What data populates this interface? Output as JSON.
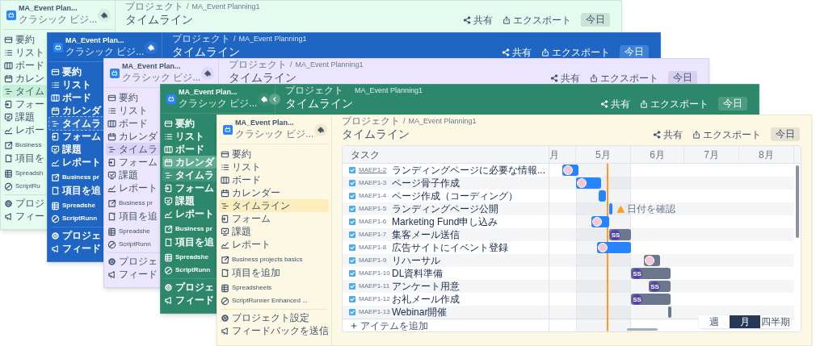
{
  "windows": [
    {
      "kind": "mint",
      "sidebar": {
        "project": "MA_Event Plan...",
        "type": "クラシック ビジ...",
        "items": [
          {
            "label": "要約",
            "selected": false,
            "hovered": false
          },
          {
            "label": "リスト",
            "selected": false,
            "hovered": false
          },
          {
            "label": "ボード",
            "selected": false,
            "hovered": false
          },
          {
            "label": "カレン",
            "selected": false,
            "hovered": false
          },
          {
            "label": "タイム",
            "selected": true,
            "hovered": false
          },
          {
            "label": "フォー",
            "selected": false,
            "hovered": false
          },
          {
            "label": "課題",
            "selected": false,
            "hovered": false
          },
          {
            "label": "レポー",
            "selected": false,
            "hovered": false
          },
          {
            "label": "Business",
            "selected": false,
            "hovered": false
          },
          {
            "label": "項目を",
            "selected": false,
            "hovered": false
          },
          {
            "label": "Spreadsh",
            "selected": false,
            "hovered": false
          },
          {
            "label": "ScriptRu",
            "selected": false,
            "hovered": false
          },
          {
            "label": "プロジ",
            "selected": false,
            "hovered": false
          },
          {
            "label": "フィー",
            "selected": false,
            "hovered": false
          }
        ]
      },
      "header": {
        "breadcrumb": [
          "プロジェクト",
          "MA_Event Planning1"
        ],
        "separator": "/",
        "title": "タイムライン",
        "share": "共有",
        "export": "エクスポート",
        "today": "今日"
      }
    },
    {
      "kind": "blue",
      "sidebar": {
        "project": "MA_Event Plan...",
        "type": "クラシック ビジ...",
        "items": [
          {
            "label": "要約",
            "selected": false,
            "hovered": false
          },
          {
            "label": "リスト",
            "selected": false,
            "hovered": false
          },
          {
            "label": "ボード",
            "selected": false,
            "hovered": false
          },
          {
            "label": "カレンダ",
            "selected": false,
            "hovered": false
          },
          {
            "label": "タイムラ",
            "selected": true,
            "hovered": false
          },
          {
            "label": "フォーム",
            "selected": false,
            "hovered": false
          },
          {
            "label": "課題",
            "selected": false,
            "hovered": false
          },
          {
            "label": "レポート",
            "selected": false,
            "hovered": false
          },
          {
            "label": "Business pr",
            "selected": false,
            "hovered": false
          },
          {
            "label": "項目を追",
            "selected": false,
            "hovered": false
          },
          {
            "label": "Spreadshe",
            "selected": false,
            "hovered": false
          },
          {
            "label": "ScriptRunn",
            "selected": false,
            "hovered": false
          },
          {
            "label": "プロジェ",
            "selected": false,
            "hovered": false
          },
          {
            "label": "フィード",
            "selected": false,
            "hovered": false
          }
        ]
      },
      "header": {
        "breadcrumb": [
          "プロジェクト",
          "MA_Event Planning1"
        ],
        "separator": "/",
        "title": "タイムライン",
        "share": "共有",
        "export": "エクスポート",
        "today": "今日"
      }
    },
    {
      "kind": "lavender",
      "sidebar": {
        "project": "MA_Event Plan...",
        "type": "クラシック ビジ...",
        "items": [
          {
            "label": "要約",
            "selected": false,
            "hovered": false
          },
          {
            "label": "リスト",
            "selected": false,
            "hovered": false
          },
          {
            "label": "ボード",
            "selected": false,
            "hovered": false
          },
          {
            "label": "カレンダ",
            "selected": false,
            "hovered": false
          },
          {
            "label": "タイムラ",
            "selected": true,
            "hovered": false
          },
          {
            "label": "フォーム",
            "selected": false,
            "hovered": false
          },
          {
            "label": "課題",
            "selected": false,
            "hovered": false
          },
          {
            "label": "レポート",
            "selected": false,
            "hovered": false
          },
          {
            "label": "Business pr",
            "selected": false,
            "hovered": false
          },
          {
            "label": "項目を追",
            "selected": false,
            "hovered": false
          },
          {
            "label": "Spreadshe",
            "selected": false,
            "hovered": false
          },
          {
            "label": "ScriptRunn",
            "selected": false,
            "hovered": false
          },
          {
            "label": "プロジェ",
            "selected": false,
            "hovered": false
          },
          {
            "label": "フィード",
            "selected": false,
            "hovered": false
          }
        ]
      },
      "header": {
        "breadcrumb": [
          "プロジェクト",
          "MA_Event Planning1"
        ],
        "separator": "/",
        "title": "タイムライン",
        "share": "共有",
        "export": "エクスポート",
        "today": "今日"
      }
    },
    {
      "kind": "green",
      "collapse_button": true,
      "sidebar": {
        "project": "MA_Event Plan...",
        "type": "クラシック ビジ...",
        "items": [
          {
            "label": "要約",
            "selected": false,
            "hovered": false
          },
          {
            "label": "リスト",
            "selected": false,
            "hovered": false
          },
          {
            "label": "ボード",
            "selected": false,
            "hovered": false
          },
          {
            "label": "カレンダ",
            "selected": false,
            "hovered": true
          },
          {
            "label": "タイムラ",
            "selected": true,
            "hovered": false
          },
          {
            "label": "フォーム",
            "selected": false,
            "hovered": false
          },
          {
            "label": "課題",
            "selected": false,
            "hovered": false
          },
          {
            "label": "レポート",
            "selected": false,
            "hovered": false
          },
          {
            "label": "Business pr",
            "selected": false,
            "hovered": false
          },
          {
            "label": "項目を追",
            "selected": false,
            "hovered": false
          },
          {
            "label": "Spreadshe",
            "selected": false,
            "hovered": false
          },
          {
            "label": "ScriptRunn",
            "selected": false,
            "hovered": false
          },
          {
            "label": "プロジェ",
            "selected": false,
            "hovered": false
          },
          {
            "label": "フィード",
            "selected": false,
            "hovered": false
          }
        ]
      },
      "header": {
        "breadcrumb": [
          "プロジェクト",
          "MA_Event Planning1"
        ],
        "title": "タイムライン",
        "share": "共有",
        "export": "エクスポート",
        "today": "今日"
      }
    },
    {
      "kind": "cream",
      "sidebar": {
        "project": "MA_Event Plan...",
        "type": "クラシック ビジ...",
        "items": [
          {
            "label": "要約",
            "selected": false,
            "hovered": false
          },
          {
            "label": "リスト",
            "selected": false,
            "hovered": false
          },
          {
            "label": "ボード",
            "selected": false,
            "hovered": false
          },
          {
            "label": "カレンダー",
            "selected": false,
            "hovered": false
          },
          {
            "label": "タイムライン",
            "selected": true,
            "hovered": false
          },
          {
            "label": "フォーム",
            "selected": false,
            "hovered": false
          },
          {
            "label": "課題",
            "selected": false,
            "hovered": false
          },
          {
            "label": "レポート",
            "selected": false,
            "hovered": false
          },
          {
            "label": "Business projects basics",
            "selected": false,
            "hovered": false
          },
          {
            "label": "項目を追加",
            "selected": false,
            "hovered": false
          },
          {
            "label": "Spreadsheets",
            "selected": false,
            "hovered": false
          },
          {
            "label": "ScriptRunner Enhanced ...",
            "selected": false,
            "hovered": false
          },
          {
            "label": "プロジェクト設定",
            "selected": false,
            "hovered": false
          },
          {
            "label": "フィードバックを送信",
            "selected": false,
            "hovered": false
          }
        ]
      },
      "header": {
        "breadcrumb": [
          "プロジェクト",
          "MA_Event Planning1"
        ],
        "separator": "/",
        "title": "タイムライン",
        "share": "共有",
        "export": "エクスポート",
        "today": "今日"
      },
      "timeline": {
        "task_heading": "タスク",
        "months": [
          "月",
          "5月",
          "6月",
          "7月",
          "8月"
        ],
        "rows": [
          {
            "key": "MAEP1-2",
            "title": "ランディングページに必要な情報...",
            "hovered": true,
            "kind": "solid",
            "avatar": {
              "kind": "photo"
            }
          },
          {
            "key": "MAEP1-3",
            "title": "ページ骨子作成",
            "hovered": false,
            "kind": "solid",
            "avatar": {
              "kind": "photo"
            }
          },
          {
            "key": "MAEP1-4",
            "title": "ページ作成（コーディング）",
            "hovered": false,
            "kind": "solid"
          },
          {
            "key": "MAEP1-5",
            "title": "ランディングページ公開",
            "hovered": false,
            "kind": "solid",
            "warning": "日付を確認"
          },
          {
            "key": "MAEP1-6",
            "title": "Marketing Fund申し込み",
            "hovered": false,
            "kind": "solid",
            "avatar": {
              "kind": "photo"
            }
          },
          {
            "key": "MAEP1-7",
            "title": "集客メール送信",
            "hovered": false,
            "kind": "muted",
            "avatar": {
              "kind": "initials",
              "initials": "SS"
            }
          },
          {
            "key": "MAEP1-8",
            "title": "広告サイトにイベント登録",
            "hovered": false,
            "kind": "solid",
            "avatar": {
              "kind": "photo"
            }
          },
          {
            "key": "MAEP1-9",
            "title": "リハーサル",
            "hovered": false,
            "kind": "muted",
            "avatar": {
              "kind": "photo"
            }
          },
          {
            "key": "MAEP1-10",
            "title": "DL資料準備",
            "hovered": false,
            "kind": "muted",
            "avatar": {
              "kind": "initials",
              "initials": "SS"
            }
          },
          {
            "key": "MAEP1-11",
            "title": "アンケート用意",
            "hovered": false,
            "kind": "muted",
            "avatar": {
              "kind": "initials",
              "initials": "SS"
            }
          },
          {
            "key": "MAEP1-12",
            "title": "お礼メール作成",
            "hovered": false,
            "kind": "muted",
            "avatar": {
              "kind": "initials",
              "initials": "SS"
            }
          },
          {
            "key": "MAEP1-13",
            "title": "Webinar開催",
            "hovered": false,
            "kind": "muted"
          }
        ],
        "add_item": "アイテムを追加",
        "zoom_options": [
          {
            "label": "週",
            "selected": false
          },
          {
            "label": "月",
            "selected": true
          },
          {
            "label": "四半期",
            "selected": false
          }
        ]
      }
    }
  ]
}
